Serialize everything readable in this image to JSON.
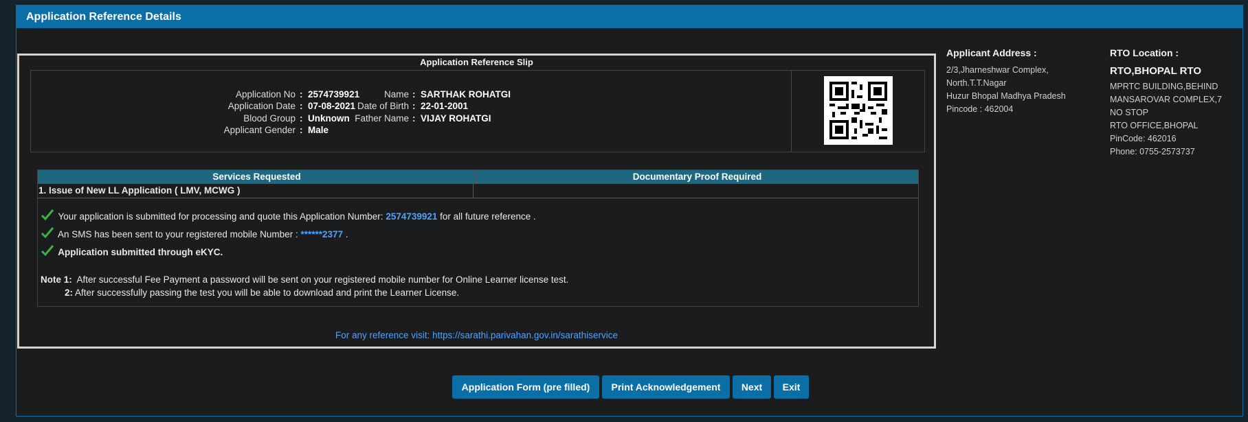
{
  "panel": {
    "title": "Application Reference Details"
  },
  "slip": {
    "title": "Application Reference Slip",
    "fields_left": [
      {
        "label": "Application No",
        "value": "2574739921"
      },
      {
        "label": "Application Date",
        "value": "07-08-2021"
      },
      {
        "label": "Blood Group",
        "value": "Unknown"
      },
      {
        "label": "Applicant Gender",
        "value": "Male"
      }
    ],
    "fields_right": [
      {
        "label": "Name",
        "value": "SARTHAK ROHATGI"
      },
      {
        "label": "Date of Birth",
        "value": "22-01-2001"
      },
      {
        "label": "Father Name",
        "value": "VIJAY ROHATGI"
      }
    ],
    "qr_icon": "qr-code-icon"
  },
  "services": {
    "header_services": "Services Requested",
    "header_docs": "Documentary Proof Required",
    "row_service": "1. Issue of New LL Application ( LMV, MCWG )",
    "row_docs": "",
    "msg1_pre": "Your application is submitted for processing and quote this Application Number:",
    "msg1_link": "2574739921",
    "msg1_post": "for all future reference .",
    "msg2_pre": "An SMS has been sent to your registered mobile Number :",
    "msg2_link": "******2377",
    "msg2_post": ".",
    "msg3": "Application submitted through eKYC.",
    "note1_label": "Note 1:",
    "note1_text": "After successful Fee Payment a password will be sent on your registered mobile number for Online Learner license test.",
    "note2_label": "2:",
    "note2_text": "After successfully passing the test you will be able to download and print the Learner License.",
    "tick_color": "#3cb043"
  },
  "reference": {
    "visit_text": "For any reference visit: https://sarathi.parivahan.gov.in/sarathiservice"
  },
  "address": {
    "heading": "Applicant Address :",
    "lines": [
      "2/3,Jharneshwar Complex,",
      "North.T.T.Nagar",
      "Huzur Bhopal Madhya Pradesh",
      "Pincode : 462004"
    ]
  },
  "rto": {
    "heading": "RTO Location :",
    "name": "RTO,BHOPAL RTO",
    "lines": [
      "MPRTC BUILDING,BEHIND",
      "MANSAROVAR COMPLEX,7",
      "NO STOP",
      "RTO OFFICE,BHOPAL",
      "PinCode:  462016",
      "Phone:  0755-2573737"
    ]
  },
  "buttons": {
    "application_form": "Application Form (pre filled)",
    "print_ack": "Print Acknowledgement",
    "next": "Next",
    "exit": "Exit"
  },
  "colors": {
    "accent": "#0a6fa6",
    "link": "#4da3ff",
    "table_header": "#1e6780"
  }
}
